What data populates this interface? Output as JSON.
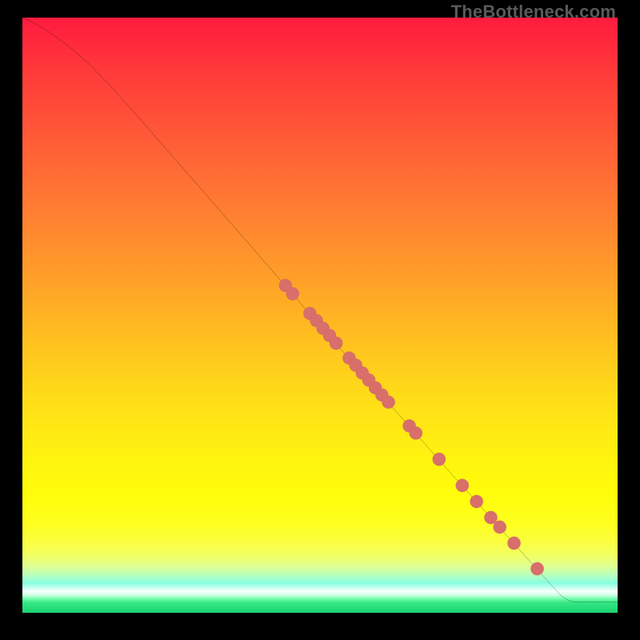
{
  "watermark": "TheBottleneck.com",
  "colors": {
    "curve": "#000000",
    "marker_fill": "#d86f6b",
    "marker_stroke": "#bf5a58"
  },
  "chart_data": {
    "type": "line",
    "title": "",
    "xlabel": "",
    "ylabel": "",
    "xlim": [
      0,
      100
    ],
    "ylim": [
      0,
      100
    ],
    "curve": [
      {
        "x": 0,
        "y": 100
      },
      {
        "x": 2,
        "y": 99.1
      },
      {
        "x": 4,
        "y": 97.9
      },
      {
        "x": 6,
        "y": 96.5
      },
      {
        "x": 8,
        "y": 95.0
      },
      {
        "x": 11,
        "y": 92.4
      },
      {
        "x": 15,
        "y": 88.3
      },
      {
        "x": 20,
        "y": 82.7
      },
      {
        "x": 26,
        "y": 75.8
      },
      {
        "x": 33,
        "y": 67.8
      },
      {
        "x": 41,
        "y": 58.6
      },
      {
        "x": 50,
        "y": 48.2
      },
      {
        "x": 58,
        "y": 39.2
      },
      {
        "x": 66,
        "y": 30.2
      },
      {
        "x": 74,
        "y": 21.2
      },
      {
        "x": 82,
        "y": 12.3
      },
      {
        "x": 88,
        "y": 5.6
      },
      {
        "x": 90.5,
        "y": 2.9
      },
      {
        "x": 91.5,
        "y": 2.2
      },
      {
        "x": 92.3,
        "y": 1.9
      },
      {
        "x": 93.2,
        "y": 1.8
      },
      {
        "x": 100,
        "y": 1.8
      }
    ],
    "markers": [
      {
        "x": 44.2,
        "y": 55.0
      },
      {
        "x": 45.4,
        "y": 53.6
      },
      {
        "x": 48.3,
        "y": 50.3
      },
      {
        "x": 49.4,
        "y": 49.1
      },
      {
        "x": 50.5,
        "y": 47.8
      },
      {
        "x": 51.6,
        "y": 46.6
      },
      {
        "x": 52.7,
        "y": 45.3
      },
      {
        "x": 54.9,
        "y": 42.8
      },
      {
        "x": 56.0,
        "y": 41.6
      },
      {
        "x": 57.1,
        "y": 40.3
      },
      {
        "x": 58.2,
        "y": 39.1
      },
      {
        "x": 59.3,
        "y": 37.8
      },
      {
        "x": 60.4,
        "y": 36.6
      },
      {
        "x": 61.5,
        "y": 35.4
      },
      {
        "x": 65.0,
        "y": 31.4
      },
      {
        "x": 66.1,
        "y": 30.2
      },
      {
        "x": 70.0,
        "y": 25.8
      },
      {
        "x": 73.9,
        "y": 21.4
      },
      {
        "x": 76.3,
        "y": 18.7
      },
      {
        "x": 78.7,
        "y": 16.0
      },
      {
        "x": 80.2,
        "y": 14.4
      },
      {
        "x": 82.6,
        "y": 11.7
      },
      {
        "x": 86.5,
        "y": 7.4
      }
    ],
    "marker_radius_pct": 1.1
  }
}
